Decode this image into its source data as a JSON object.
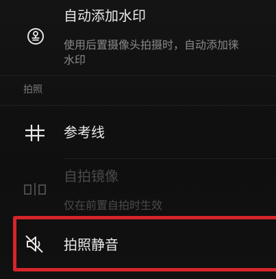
{
  "settings": {
    "watermark": {
      "title": "自动添加水印",
      "desc_line1": "使用后置摄像头拍摄时，自动添加徕",
      "desc_line2": "水印",
      "icon": "watermark-stamp-icon"
    },
    "section_photo": {
      "label": "拍照"
    },
    "guide_lines": {
      "title": "参考线",
      "icon": "grid-icon"
    },
    "selfie_mirror": {
      "title": "自拍镜像",
      "desc": "仅在前置自拍时生效",
      "icon": "mirror-flip-icon",
      "enabled": false
    },
    "mute_shutter": {
      "title": "拍照静音",
      "icon": "mute-speaker-icon"
    }
  },
  "colors": {
    "background": "#111111",
    "primary_text": "#e9e9e9",
    "secondary_text": "#8a8a8a",
    "disabled_text": "#4a4a4a",
    "highlight_border": "#d5252a"
  }
}
